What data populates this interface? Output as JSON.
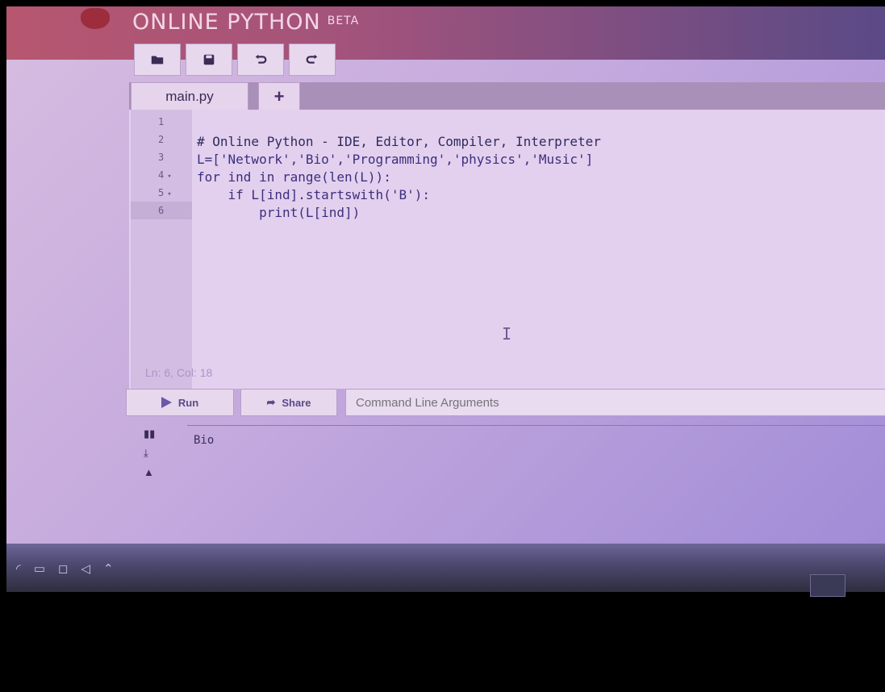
{
  "app": {
    "title": "ONLINE PYTHON",
    "badge": "BETA"
  },
  "toolbar": {
    "buttons": [
      {
        "name": "open-button",
        "icon": "folder-icon"
      },
      {
        "name": "save-button",
        "icon": "save-icon"
      },
      {
        "name": "undo-button",
        "icon": "undo-icon"
      },
      {
        "name": "redo-button",
        "icon": "redo-icon"
      }
    ]
  },
  "tabs": {
    "main": "main.py",
    "add": "+"
  },
  "editor": {
    "line_numbers": [
      "1",
      "2",
      "3",
      "4",
      "5",
      "6"
    ],
    "fold_markers": {
      "4": "▾",
      "5": "▾"
    },
    "active_line": 6,
    "lines": [
      "",
      "# Online Python - IDE, Editor, Compiler, Interpreter",
      "L=['Network','Bio','Programming','physics','Music']",
      "for ind in range(len(L)):",
      "    if L[ind].startswith('B'):",
      "        print(L[ind])"
    ],
    "status": "Ln: 6, Col: 18"
  },
  "run_bar": {
    "run_label": "Run",
    "share_label": "Share",
    "args_placeholder": "Command Line Arguments"
  },
  "output": {
    "text": "Bio"
  },
  "colors": {
    "accent": "#5a4a86",
    "code": "#3c2f7e",
    "editor_bg": "#e3d0ee"
  }
}
